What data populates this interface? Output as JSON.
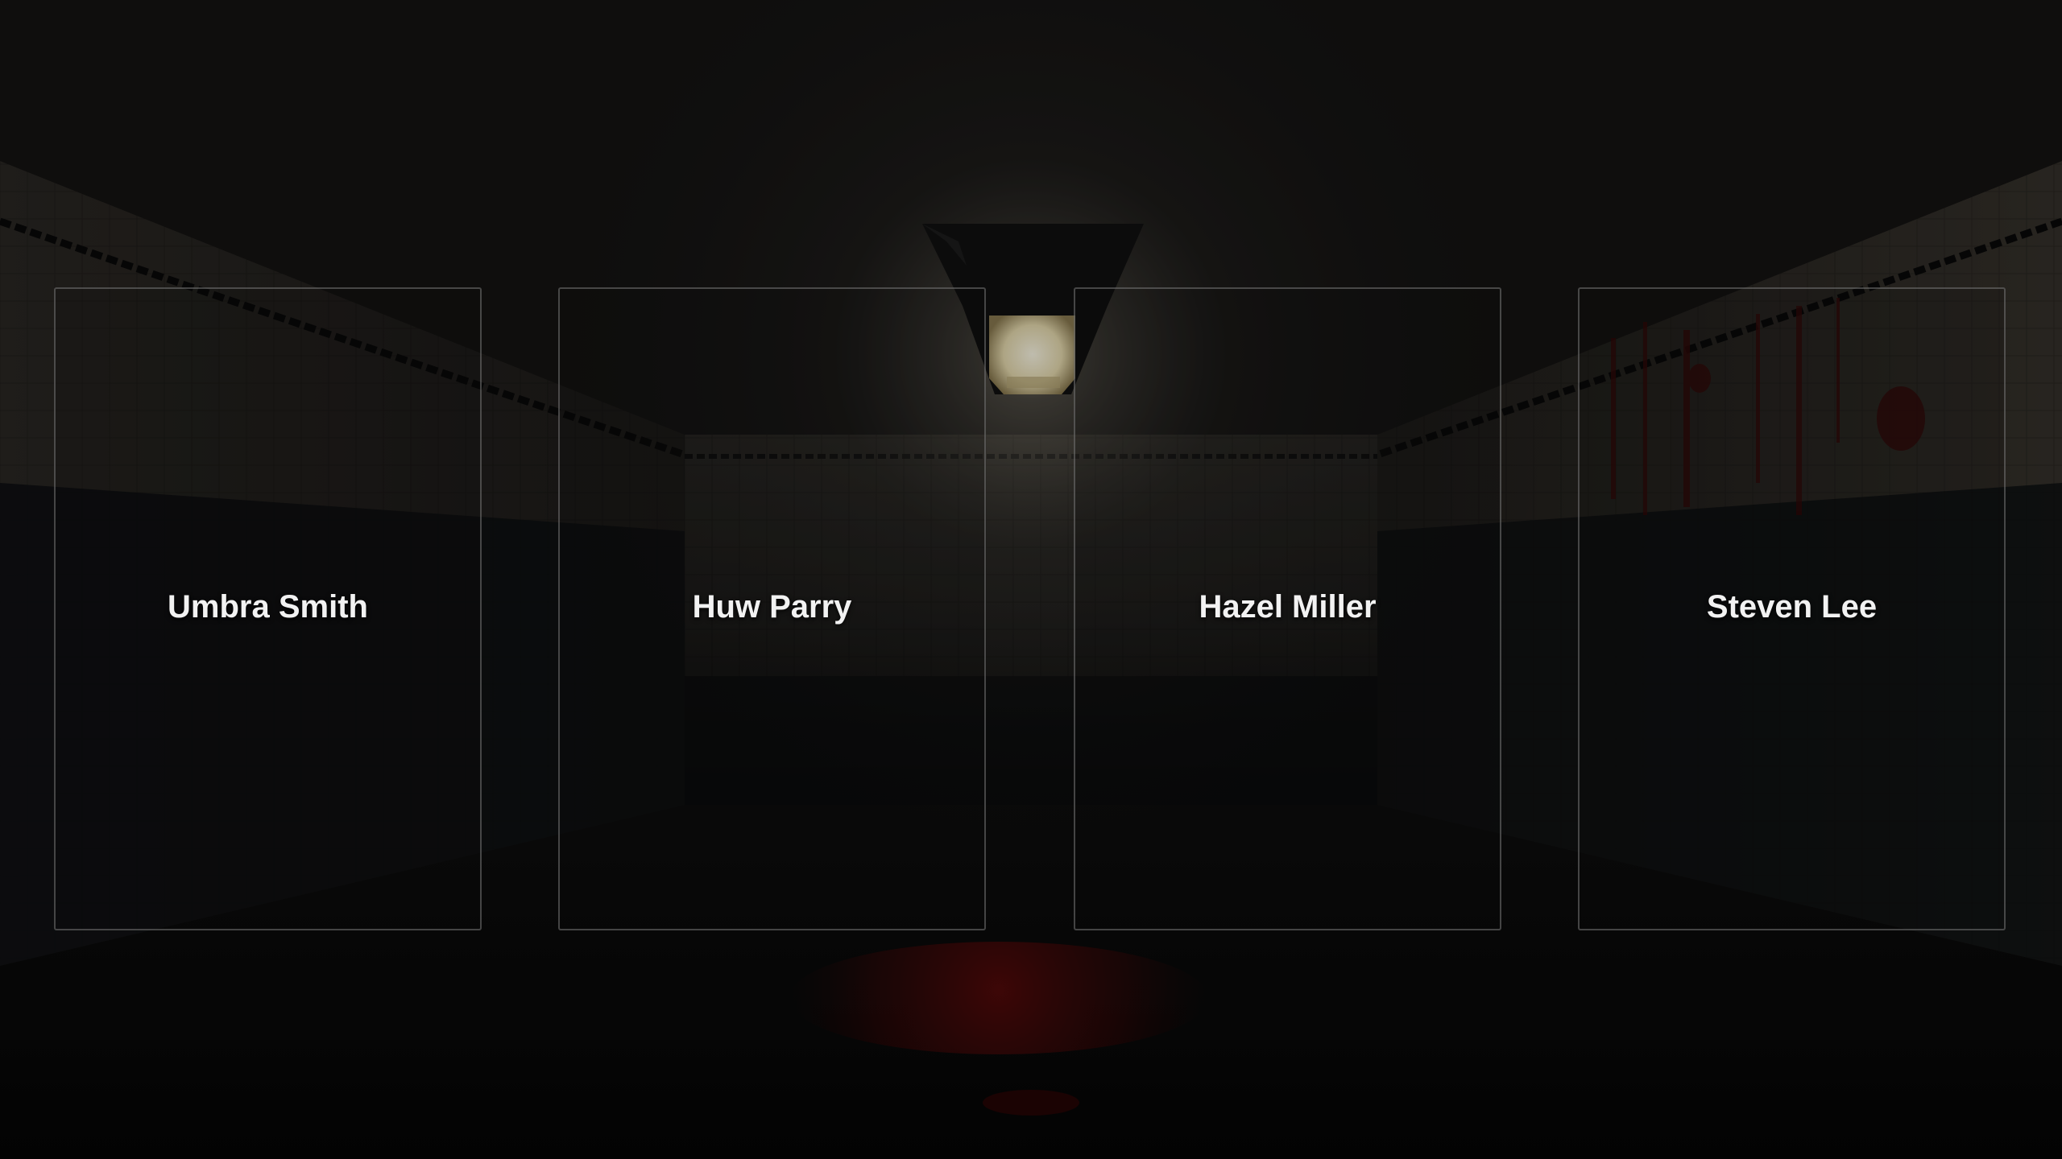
{
  "characters": [
    {
      "name": "Umbra Smith"
    },
    {
      "name": "Huw Parry"
    },
    {
      "name": "Hazel Miller"
    },
    {
      "name": "Steven Lee"
    }
  ],
  "theme": {
    "background": "#060606",
    "card_border": "#787878",
    "text": "#f2f2f2",
    "lamp_glow": "#fff6d8",
    "blood": "#5a0a0a"
  }
}
